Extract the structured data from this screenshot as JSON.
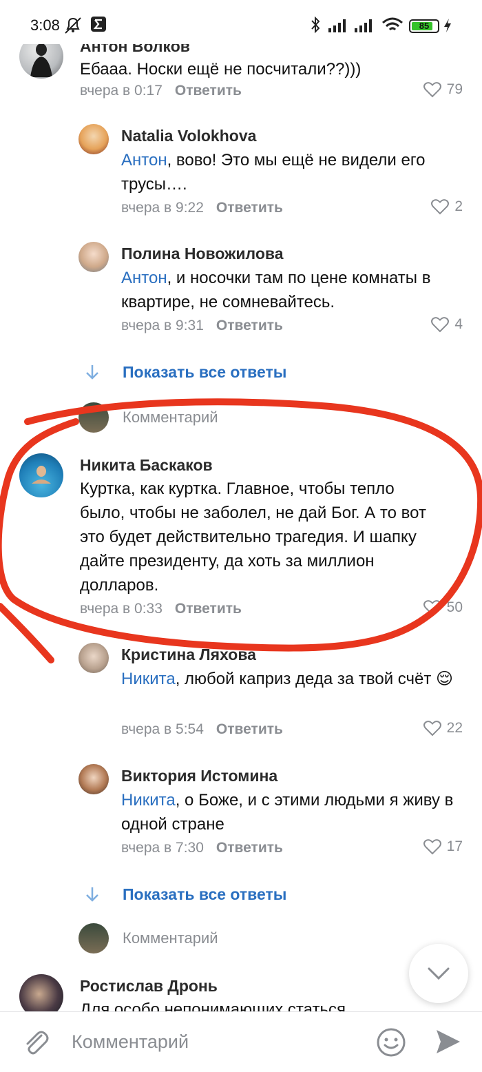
{
  "status_bar": {
    "time": "3:08",
    "battery": "85"
  },
  "comments": [
    {
      "name": "Антон Волков",
      "mention": "",
      "text": "Ебааа. Носки ещё не посчитали??)))",
      "time": "вчера в 0:17",
      "reply": "Ответить",
      "likes": "79"
    },
    {
      "name": "Natalia Volokhova",
      "mention": "Антон",
      "text": ", вово! Это мы ещё не видели его трусы….",
      "time": "вчера в 9:22",
      "reply": "Ответить",
      "likes": "2"
    },
    {
      "name": "Полина Новожилова",
      "mention": "Антон",
      "text": ", и носочки там по цене комнаты в квартире, не сомневайтесь.",
      "time": "вчера в 9:31",
      "reply": "Ответить",
      "likes": "4"
    },
    {
      "name": "Никита Баскаков",
      "mention": "",
      "text": "Куртка, как куртка. Главное, чтобы тепло было, чтобы не заболел, не дай Бог. А то вот это будет действительно трагедия. И шапку дайте президенту, да хоть за миллион долларов.",
      "time": "вчера в 0:33",
      "reply": "Ответить",
      "likes": "50"
    },
    {
      "name": "Кристина Ляхова",
      "mention": "Никита",
      "text": ", любой каприз деда за твой счёт 😌",
      "time": "вчера в 5:54",
      "reply": "Ответить",
      "likes": "22"
    },
    {
      "name": "Виктория Истомина",
      "mention": "Никита",
      "text": ", о Боже, и с этими людьми я живу в одной стране",
      "time": "вчера в 7:30",
      "reply": "Ответить",
      "likes": "17"
    },
    {
      "name": "Ростислав Дронь",
      "mention": "",
      "text": "Для особо непонимающих статься",
      "time": "",
      "reply": "",
      "likes": ""
    }
  ],
  "show_all_replies": "Показать все ответы",
  "comment_prompt": "Комментарий",
  "composer": {
    "placeholder": "Комментарий"
  },
  "colors": {
    "accent": "#2a6fc0",
    "meta": "#8a8d92",
    "annotation": "#e8361e"
  }
}
